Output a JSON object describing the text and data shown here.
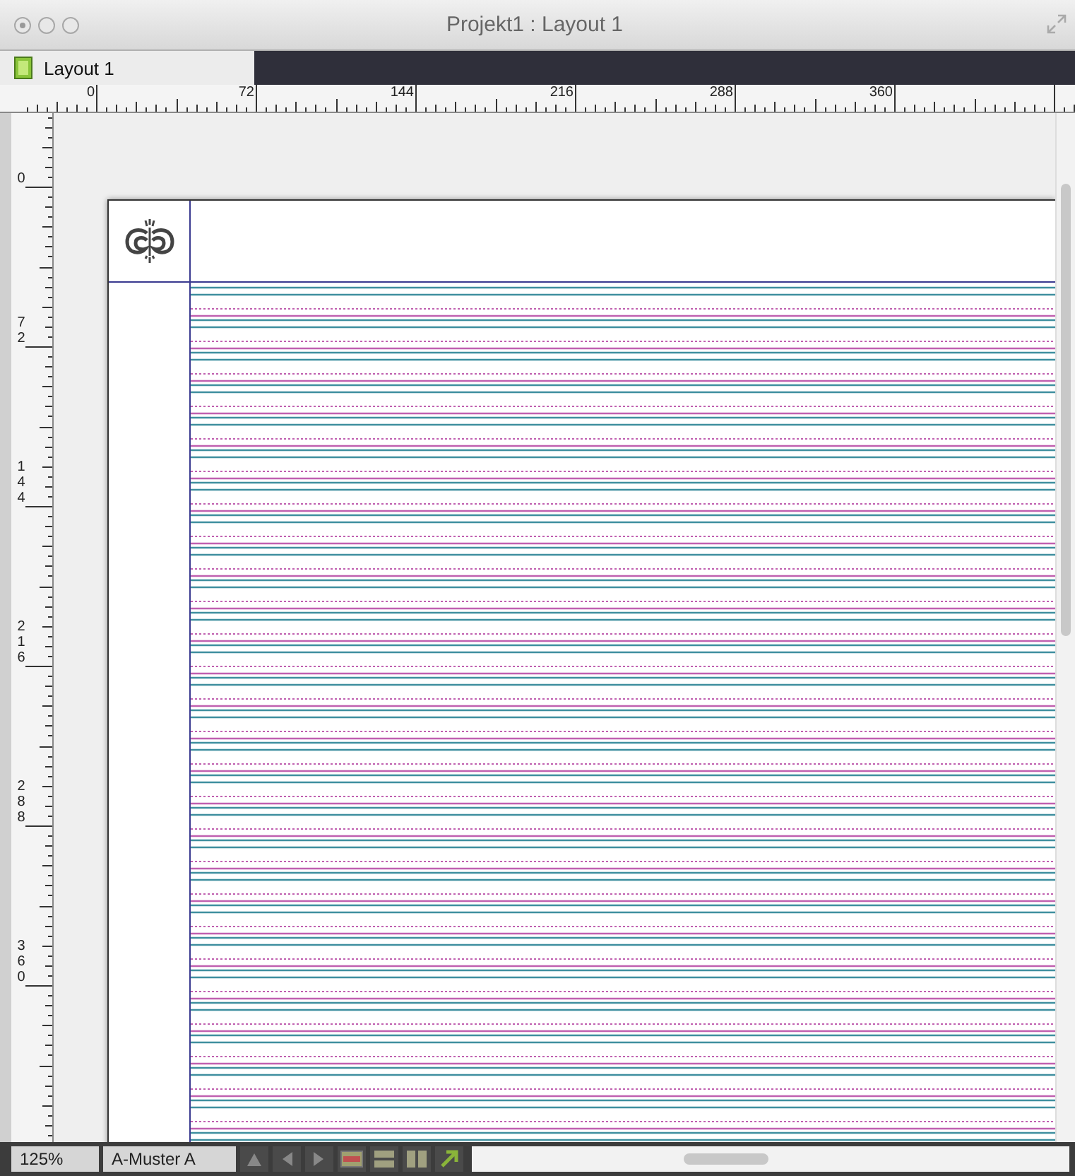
{
  "window": {
    "title": "Projekt1 : Layout 1"
  },
  "tabs": [
    {
      "label": "Layout 1",
      "selected": true
    }
  ],
  "horizontal_ruler": {
    "labels": [
      "0",
      "72",
      "144",
      "216",
      "288",
      "360"
    ]
  },
  "vertical_ruler": {
    "labels": [
      "0",
      "72",
      "144",
      "216",
      "288",
      "360"
    ]
  },
  "status_bar": {
    "zoom": "125%",
    "master_page": "A-Muster A"
  }
}
